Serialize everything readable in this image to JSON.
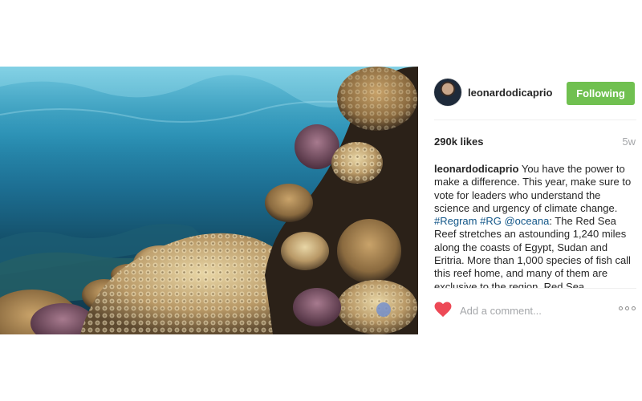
{
  "post": {
    "username": "leonardodicaprio",
    "follow_button": "Following",
    "likes": "290k likes",
    "timestamp": "5w",
    "caption": {
      "user": "leonardodicaprio",
      "text_1": " You have the power to make a difference. This year, make sure to vote for leaders who understand the science and urgency of climate change. ",
      "tag_1": "#Regram",
      "sep_1": " ",
      "tag_2": "#RG",
      "sep_2": " ",
      "tag_3": "@oceana",
      "text_2": ": The Red Sea Reef stretches an astounding 1,240 miles along the coasts of Egypt, Sudan and Eritria. More than 1,000 species of fish call this reef home, and many of them are exclusive to the region. Red Sea"
    },
    "comment_placeholder": "Add a comment...",
    "photo_alt": "Underwater coral reef photo"
  },
  "icons": {
    "like": "heart-icon",
    "more": "more-options-icon"
  },
  "colors": {
    "follow_green": "#70c050",
    "like_red": "#ed4956",
    "hashtag_blue": "#125688",
    "muted_gray": "#a5a7aa"
  }
}
